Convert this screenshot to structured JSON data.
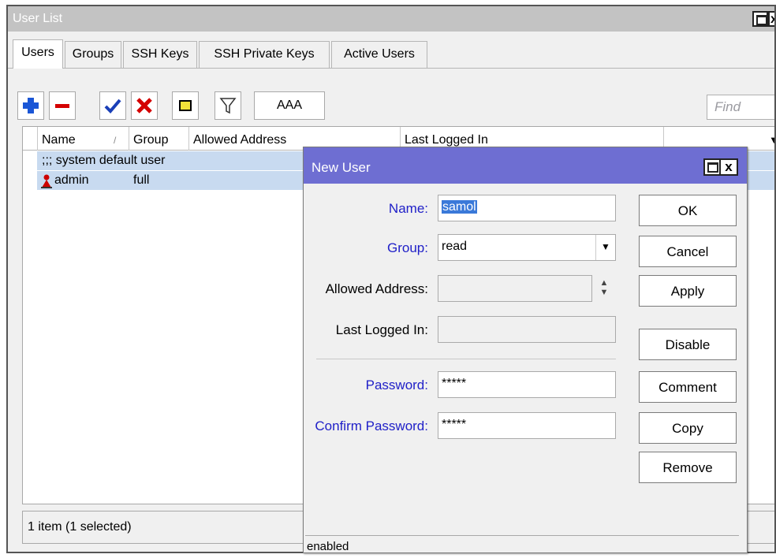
{
  "window": {
    "title": "User List",
    "close_glyph": "x"
  },
  "tabs": [
    "Users",
    "Groups",
    "SSH Keys",
    "SSH Private Keys",
    "Active Users"
  ],
  "toolbar": {
    "add_icon": "plus-icon",
    "remove_icon": "minus-icon",
    "enable_icon": "check-icon",
    "disable_icon": "x-icon",
    "comment_icon": "note-icon",
    "filter_icon": "filter-icon",
    "aaa_label": "AAA",
    "find_placeholder": "Find"
  },
  "table": {
    "columns": [
      "Name",
      "Group",
      "Allowed Address",
      "Last Logged In"
    ],
    "sort_indicator": "/",
    "rows": [
      {
        "comment": ";;; system default user"
      },
      {
        "name": "admin",
        "group": "full",
        "icon": "user-icon"
      }
    ],
    "status": "1 item (1 selected)"
  },
  "dialog": {
    "title": "New User",
    "close_glyph": "x",
    "fields": {
      "name": {
        "label": "Name:",
        "value": "samol"
      },
      "group": {
        "label": "Group:",
        "value": "read"
      },
      "allowed_address": {
        "label": "Allowed Address:",
        "value": ""
      },
      "last_logged_in": {
        "label": "Last Logged In:",
        "value": ""
      },
      "password": {
        "label": "Password:",
        "value": "*****"
      },
      "confirm_password": {
        "label": "Confirm Password:",
        "value": "*****"
      }
    },
    "buttons": [
      "OK",
      "Cancel",
      "Apply",
      "Disable",
      "Comment",
      "Copy",
      "Remove"
    ],
    "status": "enabled"
  },
  "colors": {
    "dialog_title_bg": "#6e6ed2",
    "selection_bg": "#c8daf0",
    "blue_label": "#2020c8",
    "add_icon": "#1a56d6",
    "remove_icon": "#d40000"
  }
}
